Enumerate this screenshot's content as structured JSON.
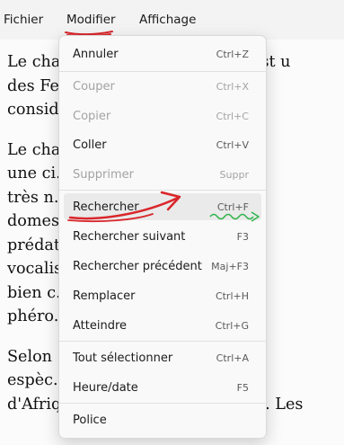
{
  "menubar": {
    "items": [
      "Fichier",
      "Modifier",
      "Affichage"
    ]
  },
  "document": {
    "paragraphs": [
      [
        "Le chat (Felis silvestris catus) est u",
        "des Felidae. Sa domestication",
        "considéré comme une espèce de"
      ],
      [
        "Le chat est un des principaux",
        "une ci... différentes",
        "très n... entre dan",
        "domes... ien et du",
        "prédat... comme le",
        "vocalis... nnement",
        "bien c... principale",
        "phéro..."
      ],
      [
        "Selon ... x menés",
        "espèc... e d'ancêt",
        "d'Afrique (Felis silvestris lybica). Les"
      ]
    ]
  },
  "edit_menu": {
    "items": [
      {
        "label": "Annuler",
        "shortcut": "Ctrl+Z",
        "enabled": true
      },
      {
        "label": "Couper",
        "shortcut": "Ctrl+X",
        "enabled": false
      },
      {
        "label": "Copier",
        "shortcut": "Ctrl+C",
        "enabled": false
      },
      {
        "label": "Coller",
        "shortcut": "Ctrl+V",
        "enabled": true
      },
      {
        "label": "Supprimer",
        "shortcut": "Suppr",
        "enabled": false
      },
      {
        "label": "Rechercher",
        "shortcut": "Ctrl+F",
        "enabled": true
      },
      {
        "label": "Rechercher suivant",
        "shortcut": "F3",
        "enabled": true
      },
      {
        "label": "Rechercher précédent",
        "shortcut": "Maj+F3",
        "enabled": true
      },
      {
        "label": "Remplacer",
        "shortcut": "Ctrl+H",
        "enabled": true
      },
      {
        "label": "Atteindre",
        "shortcut": "Ctrl+G",
        "enabled": true
      },
      {
        "label": "Tout sélectionner",
        "shortcut": "Ctrl+A",
        "enabled": true
      },
      {
        "label": "Heure/date",
        "shortcut": "F5",
        "enabled": true
      },
      {
        "label": "Police",
        "shortcut": "",
        "enabled": true
      }
    ]
  },
  "colors": {
    "annotation_red": "#d9262b",
    "annotation_green": "#2fb34a",
    "menu_bg": "#f9f9f9"
  }
}
